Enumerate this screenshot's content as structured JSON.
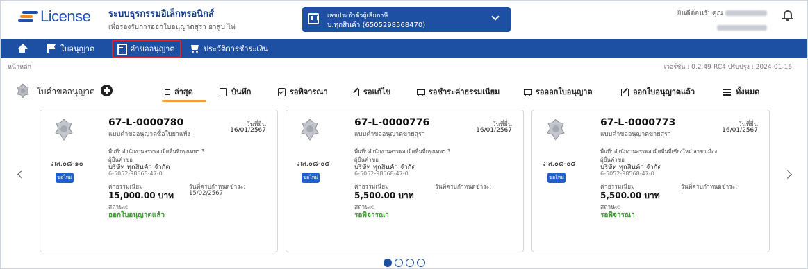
{
  "header": {
    "logo_text": "License",
    "app_title": "ระบบธุรกรรมอิเล็กทรอนิกส์",
    "app_subtitle": "เพื่อรองรับการออกใบอนุญาตสุรา ยาสูบ ไพ่",
    "taxpayer_label": "เลขประจำตัวผู้เสียภาษี",
    "taxpayer_value": "บ.ทุกสินค้า (6505298568470)",
    "welcome_text": "ยินดีต้อนรับคุณ"
  },
  "nav": {
    "items": [
      {
        "label": "ใบอนุญาต",
        "icon": "flag-icon"
      },
      {
        "label": "คำขออนุญาต",
        "icon": "document-icon"
      },
      {
        "label": "ประวัติการชำระเงิน",
        "icon": "cart-icon"
      }
    ]
  },
  "breadcrumb": "หน้าหลัก",
  "version": "เวอร์ชัน : 0.2.49-RC4 ปรับปรุง : 2024-01-16",
  "section_title": "ใบคำขออนุญาต",
  "tabs": [
    {
      "label": "ล่าสุด",
      "icon": "sort-icon"
    },
    {
      "label": "บันทึก",
      "icon": "save-icon"
    },
    {
      "label": "รอพิจารณา",
      "icon": "check-icon"
    },
    {
      "label": "รอแก้ไข",
      "icon": "edit-icon"
    },
    {
      "label": "รอชำระค่าธรรมเนียม",
      "icon": "cart-icon"
    },
    {
      "label": "รอออกใบอนุญาต",
      "icon": "cart-icon"
    },
    {
      "label": "ออกใบอนุญาตแล้ว",
      "icon": "edit-icon"
    },
    {
      "label": "ทั้งหมด",
      "icon": "menu-icon"
    }
  ],
  "cards": [
    {
      "code": "67-L-0000780",
      "subtitle": "แบบคำขออนุญาตซื้อใบยาแห้ง",
      "date_label": "วันที่ยื่น",
      "date": "16/01/2567",
      "form_code": "ภส.๐๘-๑๐",
      "badge": "ขอใหม่",
      "area": "พื้นที่: สำนักงานสรรพสามิตพื้นที่กรุงเทพฯ 3",
      "applicant_label": "ผู้ยื่นคำขอ",
      "applicant": "บริษัท ทุกสินค้า จำกัด",
      "applicant_id": "6-5052-98568-47-0",
      "fee_label": "ค่าธรรมเนียม",
      "fee": "15,000.00 บาท",
      "due_label": "วันที่ครบกำหนดชำระ:",
      "due": "15/02/2567",
      "status_label": "สถานะ:",
      "status": "ออกใบอนุญาตแล้ว"
    },
    {
      "code": "67-L-0000776",
      "subtitle": "แบบคำขออนุญาตขายสุรา",
      "date_label": "วันที่ยื่น",
      "date": "16/01/2567",
      "form_code": "ภส.๐๘-๐๕",
      "badge": "ขอใหม่",
      "area": "พื้นที่: สำนักงานสรรพสามิตพื้นที่กรุงเทพฯ 3",
      "applicant_label": "ผู้ยื่นคำขอ",
      "applicant": "บริษัท ทุกสินค้า จำกัด",
      "applicant_id": "6-5052-98568-47-0",
      "fee_label": "ค่าธรรมเนียม",
      "fee": "5,500.00 บาท",
      "due_label": "วันที่ครบกำหนดชำระ:",
      "due": "-",
      "status_label": "สถานะ:",
      "status": "รอพิจารณา"
    },
    {
      "code": "67-L-0000773",
      "subtitle": "แบบคำขออนุญาตขายสุรา",
      "date_label": "วันที่ยื่น",
      "date": "16/01/2567",
      "form_code": "ภส.๐๘-๐๕",
      "badge": "ขอใหม่",
      "area": "พื้นที่: สำนักงานสรรพสามิตพื้นที่เชียงใหม่ สาขาเมือง",
      "applicant_label": "ผู้ยื่นคำขอ",
      "applicant": "บริษัท ทุกสินค้า จำกัด",
      "applicant_id": "6-5052-98568-47-0",
      "fee_label": "ค่าธรรมเนียม",
      "fee": "5,500.00 บาท",
      "due_label": "วันที่ครบกำหนดชำระ:",
      "due": "-",
      "status_label": "สถานะ:",
      "status": "รอพิจารณา"
    }
  ],
  "pagination": {
    "pages": 4,
    "current": 1
  },
  "colors": {
    "brand": "#1d4fa3",
    "accent": "#f0a13d",
    "status_green": "#3a9b2c",
    "highlight": "#e0262b"
  }
}
